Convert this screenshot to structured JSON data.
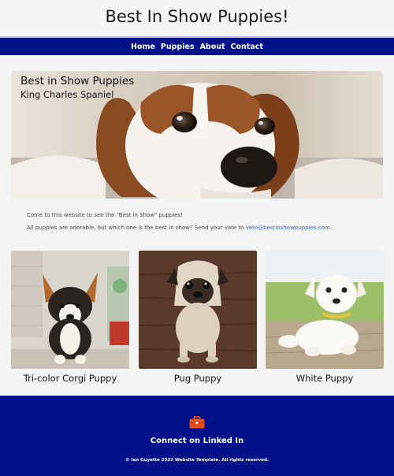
{
  "header": {
    "title": "Best In Show Puppies!"
  },
  "nav": {
    "items": [
      "Home",
      "Puppies",
      "About",
      "Contact"
    ]
  },
  "hero": {
    "title": "Best in Show Puppies",
    "subtitle": "King Charles Spaniel"
  },
  "intro": {
    "line1": "Come to this website to see the \"Best in Show\" puppies!",
    "line2_prefix": "All puppies are adorable, but which one is the best in show? Send your vote to ",
    "email": "vote@bestinshowpuppies.com",
    "line2_suffix": "."
  },
  "cards": [
    {
      "label": "Tri-color Corgi Puppy"
    },
    {
      "label": "Pug Puppy"
    },
    {
      "label": "White Puppy"
    }
  ],
  "footer": {
    "icon": "briefcase-icon",
    "cta": "Connect on Linked In",
    "copyright": "© Ian Guyette 2022 Website Template. All rights reserved."
  },
  "colors": {
    "brand_navy": "#00118a",
    "link_blue": "#3a63d8",
    "icon_orange": "#e8501a"
  }
}
